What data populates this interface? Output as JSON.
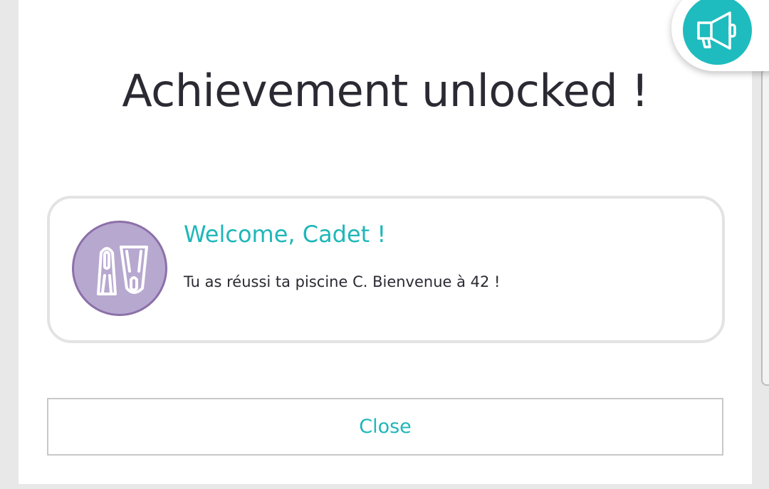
{
  "modal": {
    "title": "Achievement unlocked !",
    "close_label": "Close"
  },
  "achievement": {
    "name": "Welcome, Cadet !",
    "description": "Tu as réussi ta piscine C. Bienvenue à 42 !",
    "icon": "swim-fins-icon"
  },
  "fab": {
    "icon": "megaphone-icon"
  },
  "colors": {
    "accent": "#1fb7b9",
    "badge_fill": "#b7a8cf",
    "badge_stroke": "#8c70a8",
    "text": "#2b2a33"
  }
}
